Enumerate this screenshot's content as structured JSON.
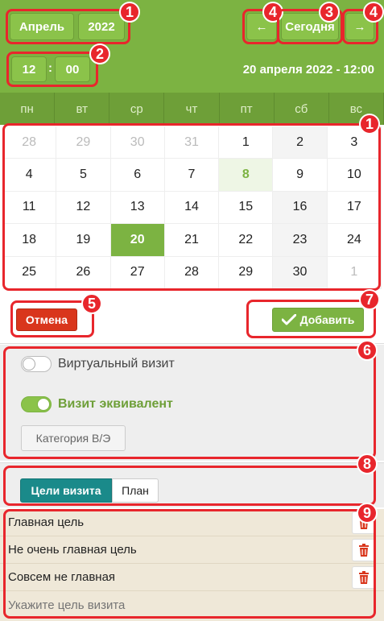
{
  "header": {
    "month_label": "Апрель",
    "year_label": "2022",
    "today_label": "Сегодня",
    "prev_arrow": "←",
    "next_arrow": "→",
    "hour": "12",
    "minute": "00",
    "colon": ":",
    "datetime_display": "20 апреля 2022 - 12:00"
  },
  "calendar": {
    "weekdays": [
      "пн",
      "вт",
      "ср",
      "чт",
      "пт",
      "сб",
      "вс"
    ],
    "days": [
      {
        "label": "28",
        "type": "muted"
      },
      {
        "label": "29",
        "type": "muted"
      },
      {
        "label": "30",
        "type": "muted"
      },
      {
        "label": "31",
        "type": "muted"
      },
      {
        "label": "1",
        "type": ""
      },
      {
        "label": "2",
        "type": "weekend"
      },
      {
        "label": "3",
        "type": ""
      },
      {
        "label": "4",
        "type": ""
      },
      {
        "label": "5",
        "type": ""
      },
      {
        "label": "6",
        "type": ""
      },
      {
        "label": "7",
        "type": ""
      },
      {
        "label": "8",
        "type": "today"
      },
      {
        "label": "9",
        "type": ""
      },
      {
        "label": "10",
        "type": ""
      },
      {
        "label": "11",
        "type": ""
      },
      {
        "label": "12",
        "type": ""
      },
      {
        "label": "13",
        "type": ""
      },
      {
        "label": "14",
        "type": ""
      },
      {
        "label": "15",
        "type": ""
      },
      {
        "label": "16",
        "type": "weekend"
      },
      {
        "label": "17",
        "type": ""
      },
      {
        "label": "18",
        "type": ""
      },
      {
        "label": "19",
        "type": ""
      },
      {
        "label": "20",
        "type": "selected"
      },
      {
        "label": "21",
        "type": ""
      },
      {
        "label": "22",
        "type": ""
      },
      {
        "label": "23",
        "type": "weekend"
      },
      {
        "label": "24",
        "type": ""
      },
      {
        "label": "25",
        "type": ""
      },
      {
        "label": "26",
        "type": ""
      },
      {
        "label": "27",
        "type": ""
      },
      {
        "label": "28",
        "type": ""
      },
      {
        "label": "29",
        "type": ""
      },
      {
        "label": "30",
        "type": "weekend"
      },
      {
        "label": "1",
        "type": "muted"
      }
    ]
  },
  "actions": {
    "cancel_label": "Отмена",
    "add_label": "Добавить",
    "add_icon": "check-icon"
  },
  "options": {
    "virtual_visit_label": "Виртуальный визит",
    "virtual_visit_on": false,
    "equivalent_visit_label": "Визит эквивалент",
    "equivalent_visit_on": true,
    "category_label": "Категория В/Э"
  },
  "tabs": {
    "goals_label": "Цели визита",
    "plan_label": "План",
    "active": "goals"
  },
  "goals": {
    "items": [
      "Главная цель",
      "Не очень главная цель",
      "Совсем не главная"
    ],
    "input_placeholder": "Укажите цель визита"
  },
  "annotations": [
    "1",
    "2",
    "3",
    "4",
    "4",
    "1",
    "5",
    "7",
    "6",
    "8",
    "9"
  ],
  "colors": {
    "accent_green": "#7cb342",
    "cancel_red": "#d9361c",
    "tab_teal": "#1a8a8a",
    "annotation_red": "#e8262c"
  }
}
